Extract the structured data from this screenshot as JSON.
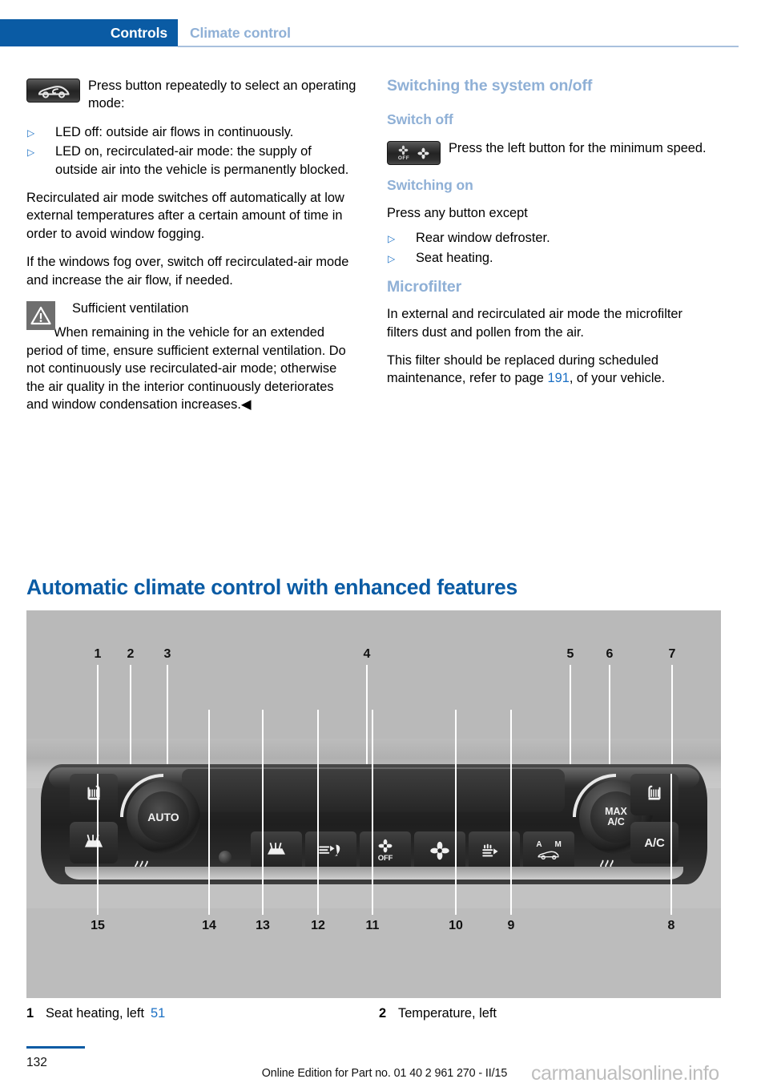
{
  "header": {
    "chapter": "Controls",
    "section": "Climate control"
  },
  "left_column": {
    "recirc_icon_text": "Press button repeatedly to select an operating mode:",
    "bullets": [
      "LED off: outside air flows in continuously.",
      "LED on, recirculated-air mode: the supply of outside air into the vehicle is permanently blocked."
    ],
    "para_auto_off": "Recirculated air mode switches off automatically at low external temperatures after a certain amount of time in order to avoid window fogging.",
    "para_fog": "If the windows fog over, switch off recirculated-air mode and increase the air flow, if needed.",
    "warning_title": "Sufficient ventilation",
    "warning_body": "When remaining in the vehicle for an extended period of time, ensure sufficient external ventilation. Do not continuously use recirculated-air mode; otherwise the air quality in the interior continuously deteriorates and window condensation increases.◀"
  },
  "right_column": {
    "heading_switching": "Switching the system on/off",
    "subheading_switch_off": "Switch off",
    "switch_off_text": "Press the left button for the minimum speed.",
    "subheading_switching_on": "Switching on",
    "switching_on_intro": "Press any button except",
    "switching_on_bullets": [
      "Rear window defroster.",
      "Seat heating."
    ],
    "heading_microfilter": "Microfilter",
    "microfilter_para1": "In external and recirculated air mode the microfilter filters dust and pollen from the air.",
    "microfilter_para2_before": "This filter should be replaced during scheduled maintenance, refer to page ",
    "microfilter_page_ref": "191",
    "microfilter_para2_after": ", of your vehicle."
  },
  "section_title": "Automatic climate control with enhanced features",
  "figure": {
    "callouts_top": [
      "1",
      "2",
      "3",
      "4",
      "5",
      "6",
      "7"
    ],
    "callouts_bottom": [
      "15",
      "14",
      "13",
      "12",
      "11",
      "10",
      "9",
      "8"
    ],
    "console_labels": {
      "auto_knob": "AUTO",
      "max_ac_knob": "MAX\nA/C",
      "ac_button": "A/C",
      "fan_off": "OFF",
      "recirc_a": "A",
      "recirc_m": "M"
    }
  },
  "legend": [
    {
      "num": "1",
      "text": "Seat heating, left",
      "ref": "51"
    },
    {
      "num": "2",
      "text": "Temperature, left",
      "ref": ""
    }
  ],
  "footer": {
    "page_number": "132",
    "note": "Online Edition for Part no. 01 40 2 961 270 - II/15",
    "watermark": "carmanualsonline.info"
  },
  "colors": {
    "brand_blue": "#0a5ba4",
    "heading_light_blue": "#8fb0d6",
    "link_blue": "#1a6fc4",
    "figure_bg": "#b9b9b9"
  }
}
